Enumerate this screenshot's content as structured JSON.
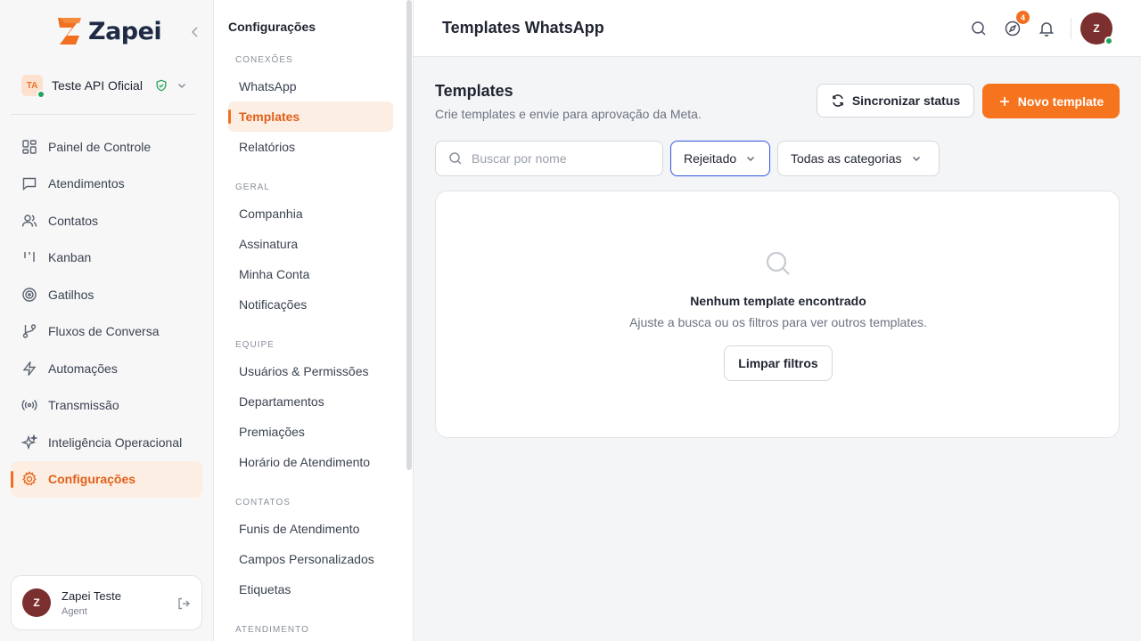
{
  "brand": {
    "name": "Zapei",
    "accent": "#f26f21"
  },
  "company": {
    "initials": "TA",
    "name": "Teste API Oficial"
  },
  "nav": {
    "items": [
      {
        "label": "Painel de Controle",
        "icon": "dashboard-icon"
      },
      {
        "label": "Atendimentos",
        "icon": "chat-icon"
      },
      {
        "label": "Contatos",
        "icon": "users-icon"
      },
      {
        "label": "Kanban",
        "icon": "kanban-icon"
      },
      {
        "label": "Gatilhos",
        "icon": "target-icon"
      },
      {
        "label": "Fluxos de Conversa",
        "icon": "flow-icon"
      },
      {
        "label": "Automações",
        "icon": "lightning-icon"
      },
      {
        "label": "Transmissão",
        "icon": "broadcast-icon"
      },
      {
        "label": "Inteligência Operacional",
        "icon": "sparkles-icon"
      },
      {
        "label": "Configurações",
        "icon": "gear-icon",
        "active": true
      }
    ]
  },
  "user": {
    "initial": "Z",
    "name": "Zapei Teste",
    "role": "Agent"
  },
  "settings": {
    "title": "Configurações",
    "sections": [
      {
        "head": "CONEXÕES",
        "items": [
          "WhatsApp",
          "Templates",
          "Relatórios"
        ]
      },
      {
        "head": "GERAL",
        "items": [
          "Companhia",
          "Assinatura",
          "Minha Conta",
          "Notificações"
        ]
      },
      {
        "head": "EQUIPE",
        "items": [
          "Usuários & Permissões",
          "Departamentos",
          "Premiações",
          "Horário de Atendimento"
        ]
      },
      {
        "head": "CONTATOS",
        "items": [
          "Funis de Atendimento",
          "Campos Personalizados",
          "Etiquetas"
        ]
      },
      {
        "head": "ATENDIMENTO",
        "items": []
      }
    ],
    "active_item": "Templates"
  },
  "topbar": {
    "title": "Templates WhatsApp",
    "badge_count": "4",
    "avatar_initial": "Z"
  },
  "main": {
    "title": "Templates",
    "subtitle": "Crie templates e envie para aprovação da Meta.",
    "sync_label": "Sincronizar status",
    "new_label": "Novo template",
    "search_placeholder": "Buscar por nome",
    "status_filter": "Rejeitado",
    "category_filter": "Todas as categorias",
    "empty_title": "Nenhum template encontrado",
    "empty_sub": "Ajuste a busca ou os filtros para ver outros templates.",
    "clear_label": "Limpar filtros"
  }
}
